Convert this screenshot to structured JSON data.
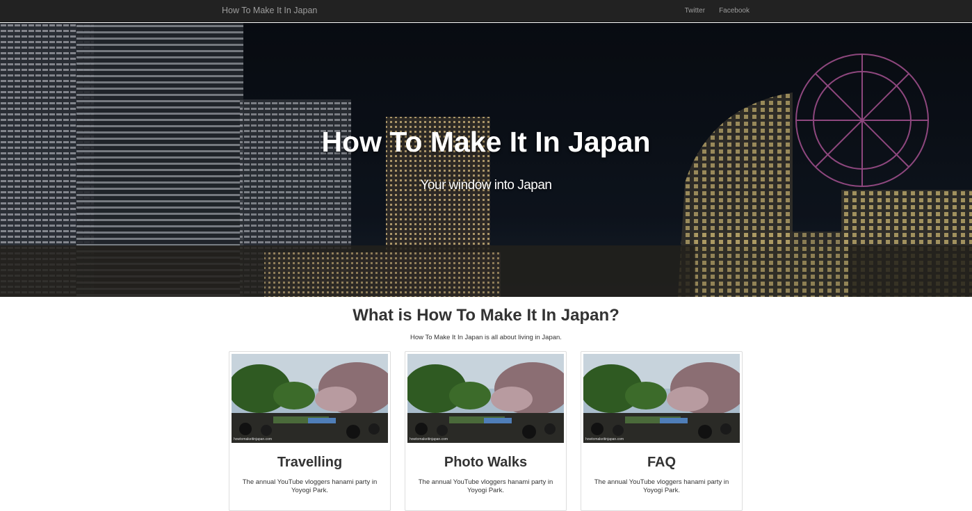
{
  "navbar": {
    "brand": "How To Make It In Japan",
    "links": [
      "Twitter",
      "Facebook"
    ]
  },
  "hero": {
    "title": "How To Make It In Japan",
    "subtitle": "Your window into Japan"
  },
  "about": {
    "title": "What is How To Make It In Japan?",
    "text": "How To Make It In Japan is all about living in Japan."
  },
  "cards": [
    {
      "title": "Travelling",
      "text": "The annual YouTube vloggers hanami party in Yoyogi Park.",
      "watermark": "howtomakeitinjapan.com"
    },
    {
      "title": "Photo Walks",
      "text": "The annual YouTube vloggers hanami party in Yoyogi Park.",
      "watermark": "howtomakeitinjapan.com"
    },
    {
      "title": "FAQ",
      "text": "The annual YouTube vloggers hanami party in Yoyogi Park.",
      "watermark": "howtomakeitinjapan.com"
    }
  ],
  "colors": {
    "navbar": "#222222",
    "nav_text": "#9d9d9d",
    "heading": "#333333"
  }
}
